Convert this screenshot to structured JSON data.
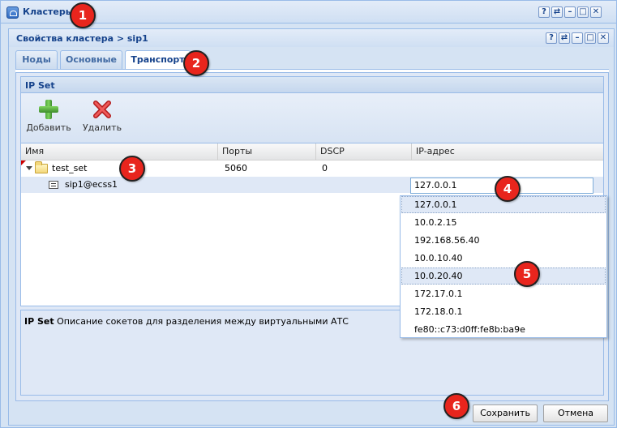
{
  "outer_window": {
    "title": "Кластеры"
  },
  "inner_window": {
    "title": "Свойства кластера > sip1"
  },
  "tool_buttons": [
    "?",
    "⇄",
    "–",
    "□",
    "✕"
  ],
  "tabs": [
    {
      "label": "Ноды"
    },
    {
      "label": "Основные"
    },
    {
      "label": "Транспорт"
    }
  ],
  "active_tab": "Транспорт",
  "ipset": {
    "title": "IP Set",
    "toolbar": {
      "add_label": "Добавить",
      "delete_label": "Удалить"
    },
    "columns": [
      "Имя",
      "Порты",
      "DSCP",
      "IP-адрес"
    ],
    "rows": [
      {
        "name": "test_set",
        "ports": "5060",
        "dscp": "0",
        "ip": ""
      },
      {
        "name": "sip1@ecss1",
        "ports": "",
        "dscp": "",
        "ip": ""
      }
    ],
    "ip_input_value": "127.0.0.1",
    "ip_options": [
      "127.0.0.1",
      "10.0.2.15",
      "192.168.56.40",
      "10.0.10.40",
      "10.0.20.40",
      "172.17.0.1",
      "172.18.0.1",
      "fe80::c73:d0ff:fe8b:ba9e"
    ]
  },
  "description": {
    "title": "IP Set",
    "text": "Описание сокетов для разделения между виртуальными АТС"
  },
  "buttons": {
    "save": "Сохранить",
    "cancel": "Отмена"
  },
  "callouts": [
    "1",
    "2",
    "3",
    "4",
    "5",
    "6"
  ],
  "colors": {
    "accent": "#15428b",
    "callout": "#e8251d",
    "panel": "#dfe8f6"
  }
}
